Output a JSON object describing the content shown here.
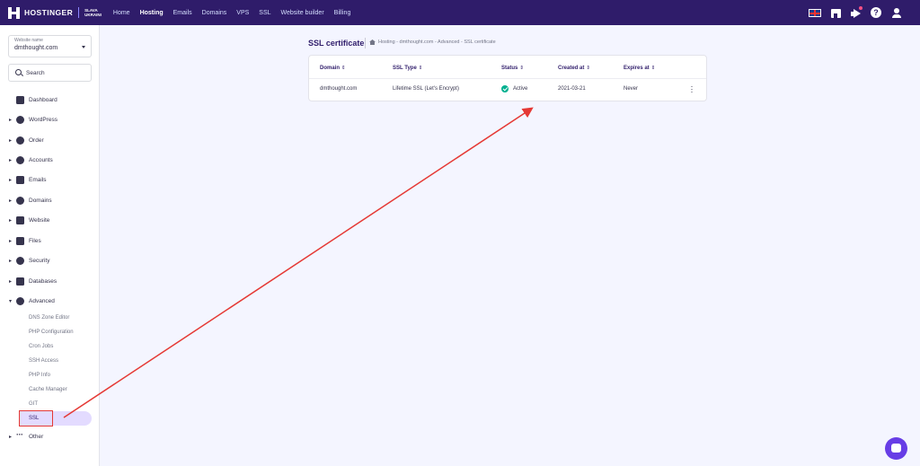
{
  "topbar": {
    "logo_text": "HOSTINGER",
    "logo_sub_1": "SLAVA",
    "logo_sub_2": "UKRAINI",
    "nav": [
      "Home",
      "Hosting",
      "Emails",
      "Domains",
      "VPS",
      "SSL",
      "Website builder",
      "Billing"
    ],
    "active_nav": "Hosting",
    "icons": [
      "uk-flag-icon",
      "store-icon",
      "megaphone-icon",
      "help-icon",
      "user-icon"
    ],
    "help_glyph": "?"
  },
  "sidebar": {
    "website_label": "Website name",
    "website_value": "dmthought.com",
    "search_placeholder": "Search",
    "items": [
      {
        "label": "Dashboard",
        "icon": "dashboard-icon"
      },
      {
        "label": "WordPress",
        "icon": "wordpress-icon"
      },
      {
        "label": "Order",
        "icon": "order-icon"
      },
      {
        "label": "Accounts",
        "icon": "accounts-icon"
      },
      {
        "label": "Emails",
        "icon": "email-icon"
      },
      {
        "label": "Domains",
        "icon": "globe-icon"
      },
      {
        "label": "Website",
        "icon": "monitor-icon"
      },
      {
        "label": "Files",
        "icon": "folder-icon"
      },
      {
        "label": "Security",
        "icon": "shield-icon"
      },
      {
        "label": "Databases",
        "icon": "database-icon"
      },
      {
        "label": "Advanced",
        "icon": "gear-icon"
      }
    ],
    "advanced_sub": [
      "DNS Zone Editor",
      "PHP Configuration",
      "Cron Jobs",
      "SSH Access",
      "PHP Info",
      "Cache Manager",
      "GIT"
    ],
    "active_sub": "SSL",
    "other_label": "Other"
  },
  "main": {
    "title": "SSL certificate",
    "breadcrumb": "Hosting  -  dmthought.com  -  Advanced  -  SSL certificate",
    "table": {
      "headers": [
        "Domain",
        "SSL Type",
        "Status",
        "Created at",
        "Expires at"
      ],
      "sort_glyph": "⇕",
      "rows": [
        {
          "domain": "dmthought.com",
          "ssl_type": "Lifetime SSL (Let's Encrypt)",
          "status": "Active",
          "created": "2021-03-21",
          "expires": "Never"
        }
      ]
    }
  },
  "colors": {
    "brand": "#2f1c6a",
    "accent": "#673de6",
    "status_ok": "#00b090",
    "annotation": "#e53935"
  }
}
